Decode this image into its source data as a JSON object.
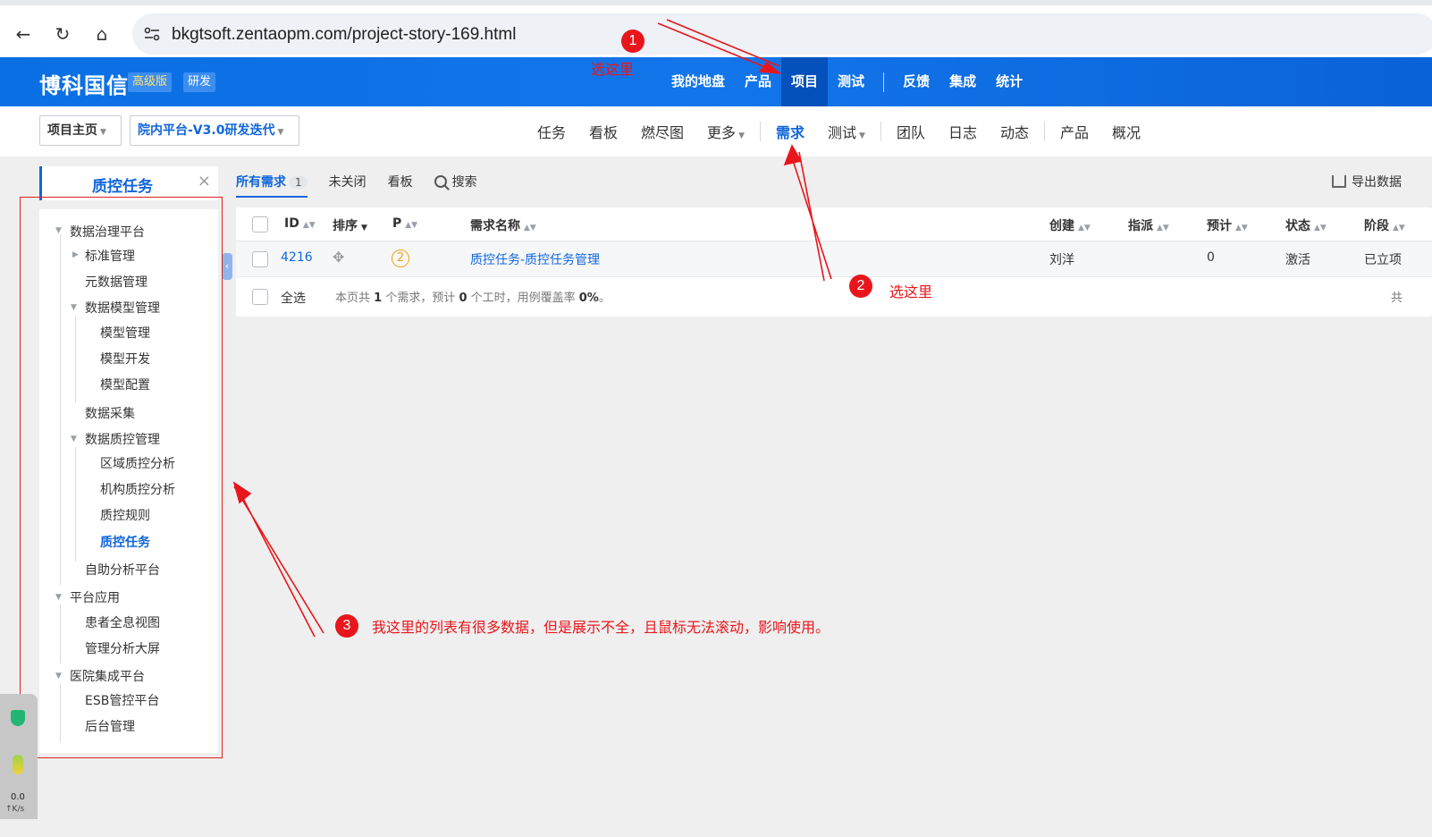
{
  "browser": {
    "url": "bkgtsoft.zentaopm.com/project-story-169.html"
  },
  "header": {
    "brand": "博科国信",
    "badge_edition": "高级版",
    "badge_role": "研发",
    "menu": [
      "我的地盘",
      "产品",
      "项目",
      "测试",
      "反馈",
      "集成",
      "统计"
    ],
    "active_menu": "项目"
  },
  "subnav": {
    "crumb_home": "项目主页",
    "crumb_iteration": "院内平台-V3.0研发迭代",
    "items": [
      "任务",
      "看板",
      "燃尽图",
      "更多",
      "需求",
      "测试",
      "团队",
      "日志",
      "动态",
      "产品",
      "概况"
    ],
    "active_item": "需求"
  },
  "left": {
    "tab_title": "质控任务",
    "close_glyph": "×",
    "tree": [
      {
        "label": "数据治理平台",
        "level": 0,
        "toggle": "▼"
      },
      {
        "label": "标准管理",
        "level": 1,
        "toggle": "▶"
      },
      {
        "label": "元数据管理",
        "level": 1
      },
      {
        "label": "数据模型管理",
        "level": 1,
        "toggle": "▼"
      },
      {
        "label": "模型管理",
        "level": 2
      },
      {
        "label": "模型开发",
        "level": 2
      },
      {
        "label": "模型配置",
        "level": 2
      },
      {
        "label": "数据采集",
        "level": 1
      },
      {
        "label": "数据质控管理",
        "level": 1,
        "toggle": "▼"
      },
      {
        "label": "区域质控分析",
        "level": 2
      },
      {
        "label": "机构质控分析",
        "level": 2
      },
      {
        "label": "质控规则",
        "level": 2
      },
      {
        "label": "质控任务",
        "level": 2,
        "active": true
      },
      {
        "label": "自助分析平台",
        "level": 1
      },
      {
        "label": "平台应用",
        "level": 0,
        "toggle": "▼"
      },
      {
        "label": "患者全息视图",
        "level": 1
      },
      {
        "label": "管理分析大屏",
        "level": 1
      },
      {
        "label": "医院集成平台",
        "level": 0,
        "toggle": "▼"
      },
      {
        "label": "ESB管控平台",
        "level": 1
      },
      {
        "label": "后台管理",
        "level": 1
      }
    ]
  },
  "filters": {
    "all_label": "所有需求",
    "all_count": "1",
    "unclosed_label": "未关闭",
    "kanban_label": "看板",
    "search_label": "搜索",
    "export_label": "导出数据"
  },
  "table": {
    "headers": {
      "id": "ID",
      "order": "排序",
      "pri": "P",
      "name": "需求名称",
      "creator": "创建",
      "assignee": "指派",
      "estimate": "预计",
      "status": "状态",
      "stage": "阶段"
    },
    "rows": [
      {
        "id": "4216",
        "pri": "2",
        "name": "质控任务-质控任务管理",
        "creator": "刘洋",
        "assignee": "",
        "estimate": "0",
        "status": "激活",
        "stage": "已立项"
      }
    ],
    "select_all": "全选",
    "summary_prefix": "本页共 ",
    "summary_count": "1",
    "summary_mid": " 个需求，预计 ",
    "summary_hours": "0",
    "summary_mid2": " 个工时，用例覆盖率 ",
    "summary_rate": "0%",
    "summary_end": "。",
    "pager_partial": "共"
  },
  "annotations": {
    "n1": "1",
    "t1": "选这里",
    "n2": "2",
    "t2": "选这里",
    "n3": "3",
    "t3": "我这里的列表有很多数据，但是展示不全，且鼠标无法滚动，影响使用。",
    "color": "#e8161c"
  },
  "widget": {
    "speed": "0.0",
    "unit": "K/s"
  }
}
